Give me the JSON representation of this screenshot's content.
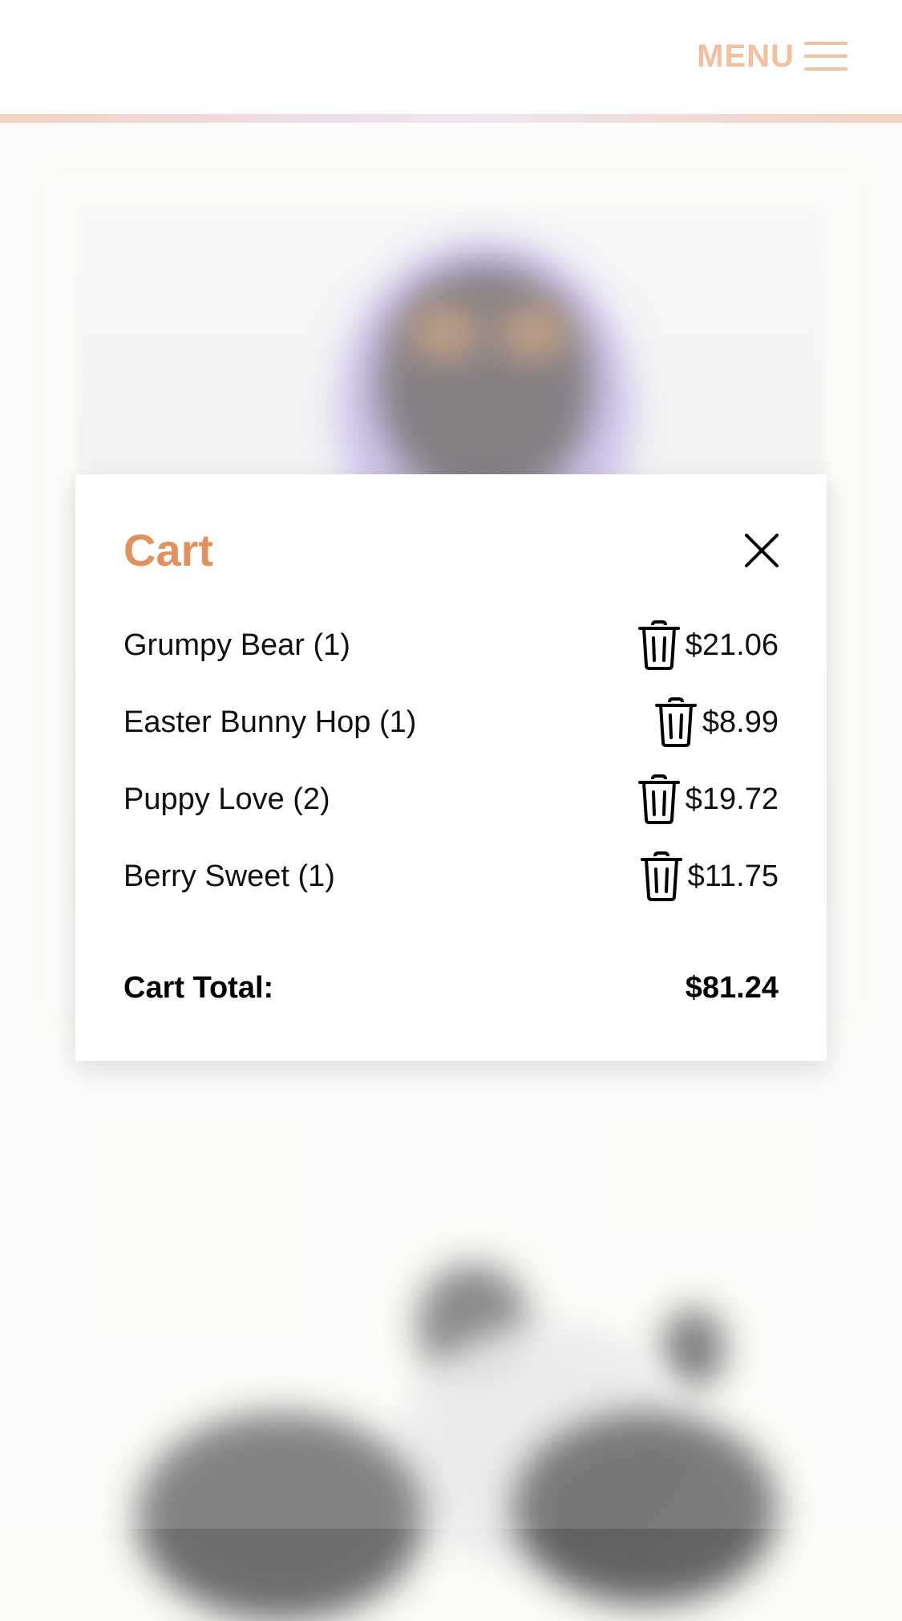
{
  "header": {
    "menu_label": "MENU",
    "accent_color": "#f0b68f"
  },
  "cart": {
    "title": "Cart",
    "title_color": "#df915f",
    "items": [
      {
        "name": "Grumpy Bear (1)",
        "price": "$21.06"
      },
      {
        "name": "Easter Bunny Hop (1)",
        "price": "$8.99"
      },
      {
        "name": "Puppy Love (2)",
        "price": "$19.72"
      },
      {
        "name": "Berry Sweet (1)",
        "price": "$11.75"
      }
    ],
    "total_label": "Cart Total:",
    "total_value": "$81.24"
  },
  "icons": {
    "menu": "hamburger-icon",
    "close": "close-icon",
    "delete": "trash-icon"
  }
}
